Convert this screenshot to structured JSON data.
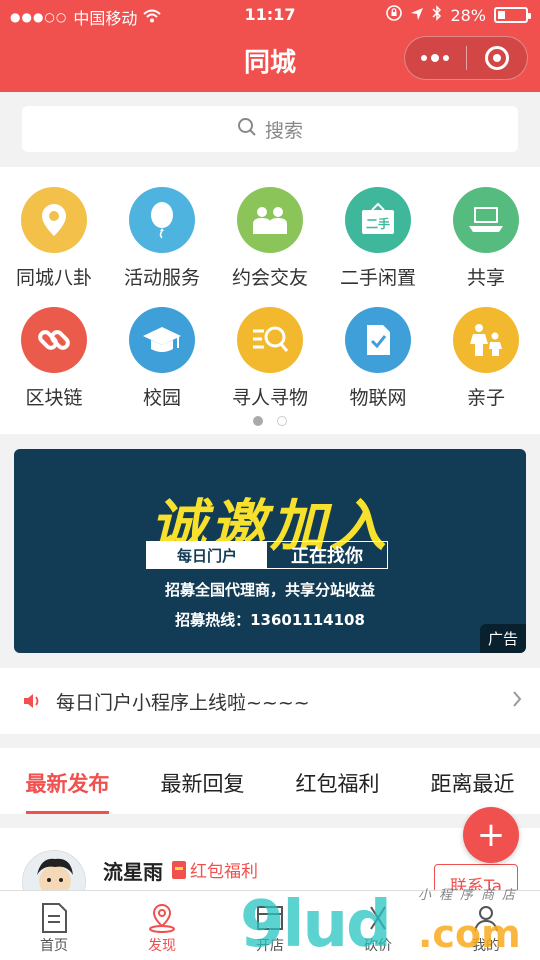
{
  "status": {
    "carrier": "中国移动",
    "time": "11:17",
    "battery": "28%",
    "battery_level": 0.28
  },
  "nav": {
    "title": "同城",
    "more_icon": "more-dots-icon",
    "close_icon": "target-circle-icon"
  },
  "search": {
    "placeholder": "搜索"
  },
  "categories": [
    {
      "label": "同城八卦",
      "icon": "location-pin-icon",
      "color": "#f3c14a"
    },
    {
      "label": "活动服务",
      "icon": "balloon-icon",
      "color": "#4fb3e0"
    },
    {
      "label": "约会交友",
      "icon": "people-icon",
      "color": "#8bc55a"
    },
    {
      "label": "二手闲置",
      "icon": "secondhand-sign-icon",
      "color": "#3fb79b"
    },
    {
      "label": "共享",
      "icon": "share-laptop-icon",
      "color": "#56bb7e"
    },
    {
      "label": "区块链",
      "icon": "chain-link-icon",
      "color": "#ea5b4b"
    },
    {
      "label": "校园",
      "icon": "graduation-cap-icon",
      "color": "#3f9fd8"
    },
    {
      "label": "寻人寻物",
      "icon": "search-list-icon",
      "color": "#f2b92f"
    },
    {
      "label": "物联网",
      "icon": "document-check-icon",
      "color": "#3f9fd8"
    },
    {
      "label": "亲子",
      "icon": "parent-child-icon",
      "color": "#f2b92f"
    }
  ],
  "banner": {
    "headline": "诚邀加入",
    "tag_left": "每日门户",
    "tag_right": "正在找你",
    "line1": "招募全国代理商，共享分站收益",
    "line2": "招募热线：13601114108",
    "ad_label": "广告"
  },
  "notice": {
    "text": "每日门户小程序上线啦~~~~"
  },
  "tabs": [
    "最新发布",
    "最新回复",
    "红包福利",
    "距离最近"
  ],
  "post": {
    "name": "流星雨",
    "tag": "红包福利",
    "contact": "联系Ta"
  },
  "fab": {
    "label": "+"
  },
  "bottom_nav": [
    {
      "label": "首页",
      "icon": "document-icon"
    },
    {
      "label": "发现",
      "icon": "location-discover-icon"
    },
    {
      "label": "开店",
      "icon": "store-icon"
    },
    {
      "label": "砍价",
      "icon": "scissors-tag-icon"
    },
    {
      "label": "我的",
      "icon": "user-icon"
    }
  ],
  "watermark": {
    "main": "9lud",
    "suffix": ".com",
    "small": "小程序商店"
  },
  "colors": {
    "brand": "#f0514f",
    "banner_bg": "#123b55",
    "banner_text": "#f8e12c"
  }
}
